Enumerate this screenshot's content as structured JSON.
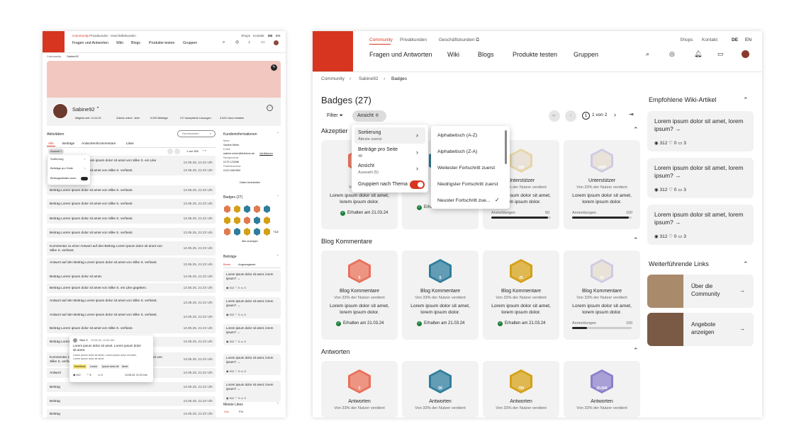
{
  "left": {
    "nav_top": [
      "Community",
      "Privatkunden",
      "Geschäftskunden"
    ],
    "nav_right": [
      "Shops",
      "Kontakt",
      "DE",
      "EN"
    ],
    "nav_main": [
      "Fragen und Antworten",
      "Wiki",
      "Blogs",
      "Produkte testen",
      "Gruppen"
    ],
    "breadcrumb": [
      "Community",
      "Sabine92"
    ],
    "profile": {
      "name": "Sabine92",
      "dot": "•",
      "stats": [
        "Mitglied seit: 11.04.20",
        "Zuletzt online: Jetzt",
        "5.290 Beiträge",
        "217 akzeptierte Lösungen",
        "3.020 Likes erhalten"
      ]
    },
    "activities": {
      "title": "Aktivitäten",
      "search_placeholder": "Durchsuchen",
      "tabs": [
        "Alle",
        "Beiträge",
        "Antworten/Kommentare",
        "Likes"
      ],
      "chip": "Ansicht",
      "pager": "1 von 555"
    },
    "menu": [
      "Sortierung",
      "Beiträge pro Seite",
      "Beitragsdetails anze..."
    ],
    "rows": [
      {
        "text": "Antwort auf den Beitrag Lorem ipsum dolor sit amet von Silke S. ein Like gegeben.",
        "date": "13.05.25, 21:23 Uhr"
      },
      {
        "text": "Beitrag Lorem ipsum dolor sit amet von Silke S. verfasst.",
        "date": "13.05.25, 21:23 Uhr"
      },
      {
        "text": "Beitrag Lorem ipsum dolor sit amet von Silke S. verfasst.",
        "date": "13.05.25, 21:23 Uhr"
      },
      {
        "text": "Beitrag Lorem ipsum dolor sit amet von Silke S. verfasst.",
        "date": "13.05.25, 21:23 Uhr"
      },
      {
        "text": "Beitrag Lorem ipsum dolor sit amet von Silke S. verfasst.",
        "date": "13.05.25, 21:23 Uhr"
      },
      {
        "text": "Beitrag Lorem ipsum dolor sit amet von Silke S. verfasst.",
        "date": "13.05.25, 21:23 Uhr"
      },
      {
        "text": "Kommentar zu einer Antwort auf den Beitrag Lorem ipsum dolor sit amet von Silke S. verfasst.",
        "date": "13.05.25, 21:23 Uhr"
      },
      {
        "text": "Antwort auf den Beitrag Lorem ipsum dolor sit amet von Silke S. verfasst.",
        "date": "13.05.25, 21:23 Uhr"
      },
      {
        "text": "Beitrag Lorem ipsum dolor sit amet.",
        "date": "13.05.25, 21:23 Uhr"
      },
      {
        "text": "Beitrag Lorem ipsum dolor sit amet von Silke S. ein Like gegeben.",
        "date": "13.05.25, 21:23 Uhr"
      },
      {
        "text": "Antwort auf den Beitrag Lorem ipsum dolor sit amet von Silke S. verfasst.",
        "date": "13.05.25, 21:23 Uhr"
      },
      {
        "text": "Antwort auf den Beitrag Lorem ipsum dolor sit amet von Silke S. verfasst.",
        "date": "13.05.25, 21:23 Uhr"
      },
      {
        "text": "Beitrag Lorem ipsum dolor sit amet von Silke S. verfasst.",
        "date": "13.05.25, 21:23 Uhr"
      },
      {
        "text": "Beitrag Lorem ipsum dolor sit amet von Silke S. verfasst.",
        "date": "13.05.25, 21:23 Uhr"
      },
      {
        "text": "Kommentar zu einer Antwort auf den Beitrag Lorem ipsum dolor sit amet von Silke S. verfasst.",
        "date": "13.05.25, 21:23 Uhr"
      },
      {
        "text": "Antwort",
        "date": "13.05.25, 21:23 Uhr"
      },
      {
        "text": "Beitrag",
        "date": "13.05.25, 21:23 Uhr"
      },
      {
        "text": "Beitrag",
        "date": "13.05.25, 21:23 Uhr"
      },
      {
        "text": "Beitrag",
        "date": "13.05.25, 21:23 Uhr"
      }
    ],
    "tooltip": {
      "user": "Silke S.",
      "time": "13.06.25, 12:05 Uhr",
      "title": "Lorem ipsum dolor sit amet. Lorem ipsum dolor sit amet.",
      "body": "Lorem ipsum dolor sit amet, Lorem ipsum dolor sit amet, Lorem ipsum dolor sit amet.",
      "tags": [
        "Mobilfunk",
        "Lorem",
        "Ipsum dolor sit",
        "Amet"
      ],
      "stats": [
        "312",
        "6",
        "3"
      ],
      "date": "13.06.25, 21:23 Uhr"
    },
    "customer": {
      "title": "Kundeninformationen",
      "l1": "Name",
      "v1": "Sabine Meier",
      "l2": "E-Mail",
      "v2": "sabine.meier@telekom.de",
      "verify": "Verifizieren",
      "l3": "Handynummer",
      "v3": "0175 123456",
      "l4": "Festnetznummer",
      "v4": "0123 4567890",
      "edit": "Daten bearbeiten"
    },
    "badges": {
      "title": "Badges (27)",
      "more": "+12",
      "all": "Alle anzeigen"
    },
    "beitraege": {
      "title": "Beiträge",
      "tabs": [
        "Beste",
        "Angesagteste"
      ],
      "q": "Lorem ipsum dolor sit amet, lorem ipsum? →",
      "stats": [
        "312",
        "0",
        "3"
      ]
    },
    "meiste": {
      "title": "Meiste Likes",
      "tabs": [
        "Von",
        "Für"
      ]
    }
  },
  "right": {
    "nav_top": [
      "Community",
      "Privatkunden",
      "Geschäftskunden"
    ],
    "nav_right": [
      "Shops",
      "Kontakt",
      "DE",
      "EN"
    ],
    "nav_main": [
      "Fragen und Antworten",
      "Wiki",
      "Blogs",
      "Produkte testen",
      "Gruppen"
    ],
    "breadcrumb": [
      "Community",
      "Sabine92",
      "Badges"
    ],
    "page_title": "Badges (27)",
    "filter": "Filter",
    "view": "Ansicht",
    "pager": "1 von 2",
    "section1": "Akzeptier",
    "dropdown": {
      "sort": "Sortierung",
      "sort_sub": "Älteste zuerst",
      "per_page": "Beiträge pro Seite",
      "per_page_sub": "48",
      "view": "Ansicht",
      "view_sub": "Auswahl (5)",
      "group": "Gruppiert nach Thema"
    },
    "sort_options": [
      "Alphabetisch (A-Z)",
      "Alphabetisch (Z-A)",
      "Weitester Fortschritt zuerst",
      "Niedrigster Fortschritt zuerst",
      "Neuster Fortschritt zue..."
    ],
    "row1": [
      {
        "title": "Unte",
        "sub": "Von 33% de",
        "desc": "Lorem ipsum dolor sit amet, lorem ipsum dolor.",
        "date": "Erhalten am 21.03.24"
      },
      {
        "title": "",
        "sub": "",
        "desc": "",
        "date": "Erhalten am 21.03.24"
      },
      {
        "title": "Unterstützer",
        "sub": "Von 33% der Nutzer verdient",
        "desc": "Lorem ipsum dolor sit amet, lorem ipsum dolor.",
        "label": "100",
        "prog_label": "Anmeldungen",
        "prog_max": "50",
        "progress": 0.95
      },
      {
        "title": "Unterstützer",
        "sub": "Von 33% der Nutzer verdient",
        "desc": "Lorem ipsum dolor sit amet, lorem ipsum dolor.",
        "label": "1000",
        "prog_label": "Anmeldungen",
        "prog_max": "100",
        "progress": 0.95
      }
    ],
    "section2": "Blog Kommentare",
    "row2": [
      {
        "title": "Blog Kommentare",
        "sub": "Von 33% der Nutzer verdient",
        "desc": "Lorem ipsum dolor sit amet, lorem ipsum dolor.",
        "date": "Erhalten am 21.03.24",
        "label": "5"
      },
      {
        "title": "Blog Kommentare",
        "sub": "Von 33% der Nutzer verdient",
        "desc": "Lorem ipsum dolor sit amet, lorem ipsum dolor.",
        "date": "Erhalten am 21.03.24",
        "label": "5"
      },
      {
        "title": "Blog Kommentare",
        "sub": "Von 33% der Nutzer verdient",
        "desc": "Lorem ipsum dolor sit amet, lorem ipsum dolor.",
        "date": "Erhalten am 21.03.24",
        "label": "25"
      },
      {
        "title": "Blog Kommentare",
        "sub": "Von 33% der Nutzer verdient",
        "desc": "Lorem ipsum dolor sit amet, lorem ipsum dolor.",
        "label": "50",
        "prog_label": "Anmeldungen",
        "prog_max": "100",
        "progress": 0.25
      }
    ],
    "section3": "Antworten",
    "row3": [
      {
        "title": "Antworten",
        "sub": "Von 33% der Nutzer verdient",
        "label": "3"
      },
      {
        "title": "Antworten",
        "sub": "Von 33% der Nutzer verdient",
        "label": "50"
      },
      {
        "title": "Antworten",
        "sub": "Von 33% der Nutzer verdient",
        "label": "750"
      },
      {
        "title": "Antworten",
        "sub": "Von 33% der Nutzer verdient",
        "label": "20.000"
      }
    ],
    "wiki_title": "Empfohlene Wiki-Artikel",
    "wiki": [
      {
        "q": "Lorem ipsum dolor sit amet, lorem ipsum? →",
        "views": "312",
        "likes": "0",
        "comments": "3"
      },
      {
        "q": "Lorem ipsum dolor sit amet, lorem ipsum? →",
        "views": "312",
        "likes": "0",
        "comments": "3"
      },
      {
        "q": "Lorem ipsum dolor sit amet, lorem ipsum? →",
        "views": "312",
        "likes": "0",
        "comments": "3"
      }
    ],
    "links_title": "Weiterführende Links",
    "links": [
      "Über die Community",
      "Angebote anzeigen"
    ],
    "colors": {
      "brand": "#d7351f",
      "bronze": "#e8705a",
      "teal": "#2f7d9c",
      "gold": "#d4a017",
      "lavender": "#8b80c9",
      "green": "#1a7f37"
    }
  }
}
